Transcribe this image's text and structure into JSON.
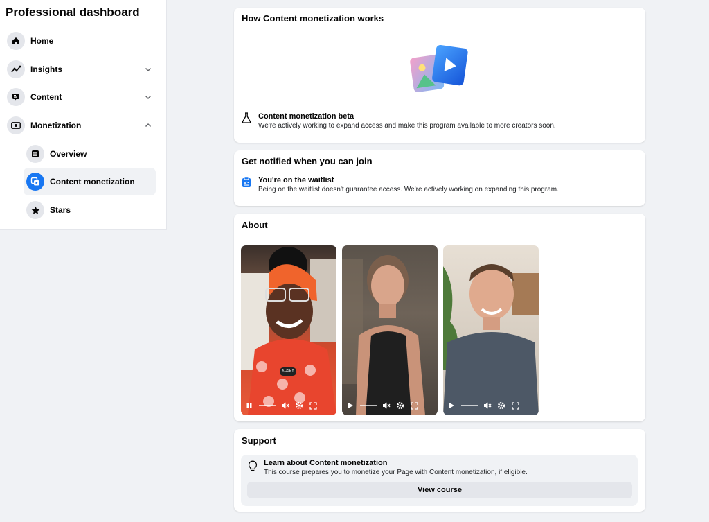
{
  "sidebar": {
    "title": "Professional dashboard",
    "items": [
      {
        "label": "Home",
        "icon": "home-icon"
      },
      {
        "label": "Insights",
        "icon": "insights-icon"
      },
      {
        "label": "Content",
        "icon": "content-icon"
      },
      {
        "label": "Monetization",
        "icon": "monetization-icon"
      }
    ],
    "subitems": [
      {
        "label": "Overview",
        "icon": "overview-icon"
      },
      {
        "label": "Content monetization",
        "icon": "content-monetization-icon",
        "active": true
      },
      {
        "label": "Stars",
        "icon": "stars-icon"
      }
    ]
  },
  "how_card": {
    "title": "How Content monetization works",
    "beta_title": "Content monetization beta",
    "beta_desc": "We're actively working to expand access and make this program available to more creators soon."
  },
  "notify_card": {
    "title": "Get notified when you can join",
    "waitlist_title": "You're on the waitlist",
    "waitlist_desc": "Being on the waitlist doesn't guarantee access. We're actively working on expanding this program."
  },
  "about_card": {
    "title": "About",
    "videos": [
      {
        "badge": "KOSEY",
        "state": "playing"
      },
      {
        "state": "paused"
      },
      {
        "state": "paused"
      }
    ]
  },
  "support_card": {
    "title": "Support",
    "learn_title": "Learn about Content monetization",
    "learn_desc": "This course prepares you to monetize your Page with Content monetization, if eligible.",
    "button": "View course"
  },
  "colors": {
    "accent": "#1877f2",
    "background": "#f0f2f5",
    "card": "#ffffff",
    "button_bg": "#e4e6eb"
  }
}
